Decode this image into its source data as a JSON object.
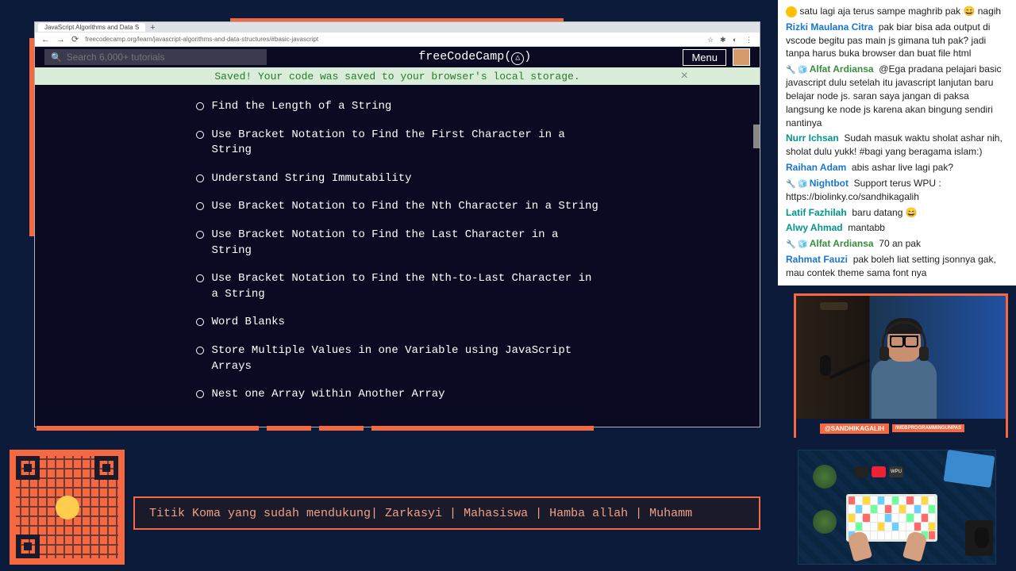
{
  "browser": {
    "tab_title": "JavaScript Algorithms and Data S",
    "url": "freecodecamp.org/learn/javascript-algorithms-and-data-structures/#basic-javascript"
  },
  "fcc": {
    "search_placeholder": "Search 6,000+ tutorials",
    "logo": "freeCodeCamp",
    "menu": "Menu",
    "save_banner": "Saved! Your code was saved to your browser's local storage."
  },
  "lessons": [
    "Find the Length of a String",
    "Use Bracket Notation to Find the First Character in a String",
    "Understand String Immutability",
    "Use Bracket Notation to Find the Nth Character in a String",
    "Use Bracket Notation to Find the Last Character in a String",
    "Use Bracket Notation to Find the Nth-to-Last Character in a String",
    "Word Blanks",
    "Store Multiple Values in one Variable using JavaScript Arrays",
    "Nest one Array within Another Array"
  ],
  "chat": [
    {
      "user": "",
      "color": "",
      "text": "satu lagi aja terus sampe maghrib pak 😄 nagih",
      "badges": ""
    },
    {
      "user": "Rizki Maulana Citra",
      "color": "c-blue",
      "text": "pak biar bisa ada output di vscode begitu pas main js gimana tuh pak? jadi tanpa harus buka browser dan buat file html",
      "badges": ""
    },
    {
      "user": "Alfat Ardiansa",
      "color": "c-green",
      "text": "@Ega pradana pelajari basic javascript dulu setelah itu javascript lanjutan baru belajar node js. saran saya jangan di paksa langsung ke node js karena akan bingung sendiri nantinya",
      "badges": "🔧 🧊"
    },
    {
      "user": "Nurr Ichsan",
      "color": "c-teal",
      "text": "Sudah masuk waktu sholat ashar nih, sholat dulu yukk! #bagi yang beragama islam:)",
      "badges": ""
    },
    {
      "user": "Raihan Adam",
      "color": "c-blue",
      "text": "abis ashar live lagi pak?",
      "badges": ""
    },
    {
      "user": "Nightbot",
      "color": "c-blue",
      "text": "Support terus WPU : https://biolinky.co/sandhikagalih",
      "badges": "🔧 🧊"
    },
    {
      "user": "Latif Fazhilah",
      "color": "c-teal",
      "text": "baru datang 😄",
      "badges": ""
    },
    {
      "user": "Alwy Ahmad",
      "color": "c-teal",
      "text": "mantabb",
      "badges": ""
    },
    {
      "user": "Alfat Ardiansa",
      "color": "c-green",
      "text": "70 an pak",
      "badges": "🔧 🧊"
    },
    {
      "user": "Rahmat Fauzi",
      "color": "c-blue",
      "text": "pak boleh liat setting jsonnya gak, mau contek theme sama font nya",
      "badges": ""
    }
  ],
  "webcam": {
    "handle": "@SANDHIKAGALIH",
    "sub": "/WEBPROGRAMMINGUNPAS"
  },
  "keyboard": {
    "label": "WPU"
  },
  "ticker": "Titik Koma yang sudah mendukung| Zarkasyi | Mahasiswa | Hamba allah | Muhamm"
}
